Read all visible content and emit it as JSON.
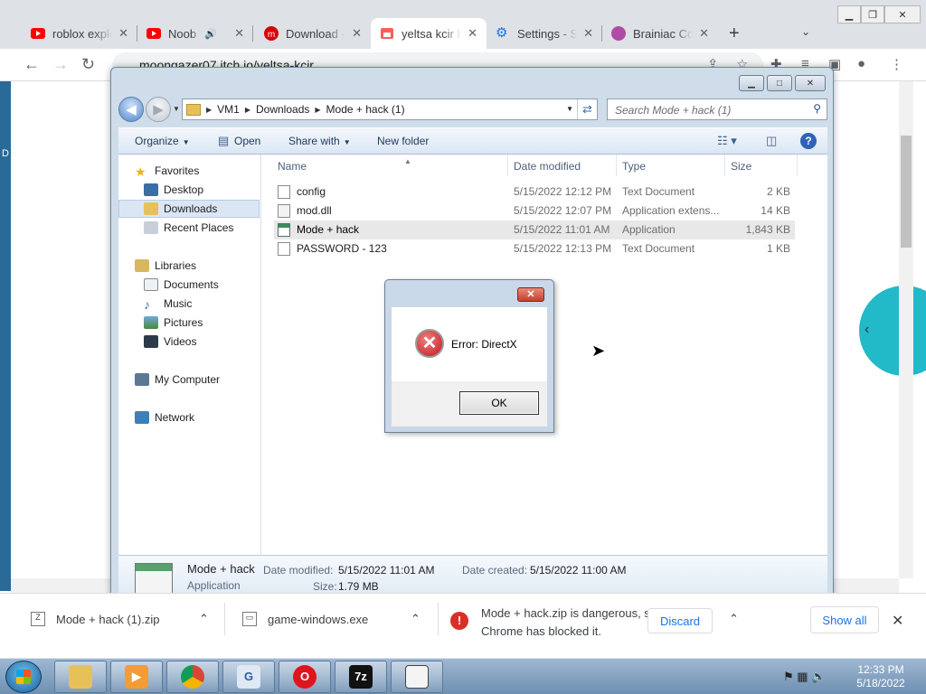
{
  "chrome": {
    "tabs": [
      {
        "title": "roblox explo",
        "favicon": "youtube-icon"
      },
      {
        "title": "Noob W",
        "favicon": "youtube-icon",
        "audio": true
      },
      {
        "title": "Download -",
        "favicon": "mega-icon"
      },
      {
        "title": "yeltsa kcir b",
        "favicon": "itch-icon",
        "active": true
      },
      {
        "title": "Settings - S",
        "favicon": "gear-icon"
      },
      {
        "title": "Brainiac Co",
        "favicon": "brain-icon"
      }
    ],
    "url": "moongazer07.itch.io/yeltsa-kcir",
    "colors": {
      "tabstrip": "#dee1e6",
      "accent": "#1a73e8"
    }
  },
  "explorer": {
    "breadcrumb": [
      "VM1",
      "Downloads",
      "Mode + hack (1)"
    ],
    "search_placeholder": "Search Mode + hack (1)",
    "commands": {
      "organize": "Organize",
      "open": "Open",
      "share": "Share with",
      "new_folder": "New folder"
    },
    "nav": {
      "favorites": "Favorites",
      "desktop": "Desktop",
      "downloads": "Downloads",
      "recent": "Recent Places",
      "libraries": "Libraries",
      "documents": "Documents",
      "music": "Music",
      "pictures": "Pictures",
      "videos": "Videos",
      "computer": "My Computer",
      "network": "Network"
    },
    "columns": {
      "name": "Name",
      "date": "Date modified",
      "type": "Type",
      "size": "Size"
    },
    "files": [
      {
        "name": "config",
        "date": "5/15/2022 12:12 PM",
        "type": "Text Document",
        "size": "2 KB"
      },
      {
        "name": "mod.dll",
        "date": "5/15/2022 12:07 PM",
        "type": "Application extens...",
        "size": "14 KB"
      },
      {
        "name": "Mode + hack",
        "date": "5/15/2022 11:01 AM",
        "type": "Application",
        "size": "1,843 KB"
      },
      {
        "name": "PASSWORD - 123",
        "date": "5/15/2022 12:13 PM",
        "type": "Text Document",
        "size": "1 KB"
      }
    ],
    "details": {
      "name": "Mode + hack",
      "kind": "Application",
      "modified_label": "Date modified:",
      "modified": "5/15/2022 11:01 AM",
      "created_label": "Date created:",
      "created": "5/15/2022 11:00 AM",
      "size_label": "Size:",
      "size": "1.79 MB"
    }
  },
  "dialog": {
    "message": "Error: DirectX",
    "ok": "OK"
  },
  "downloads": {
    "item1": "Mode + hack (1).zip",
    "item2": "game-windows.exe",
    "warning": "Mode + hack.zip is dangerous, so Chrome has blocked it.",
    "discard": "Discard",
    "show_all": "Show all"
  },
  "taskbar": {
    "time": "12:33 PM",
    "date": "5/18/2022"
  }
}
